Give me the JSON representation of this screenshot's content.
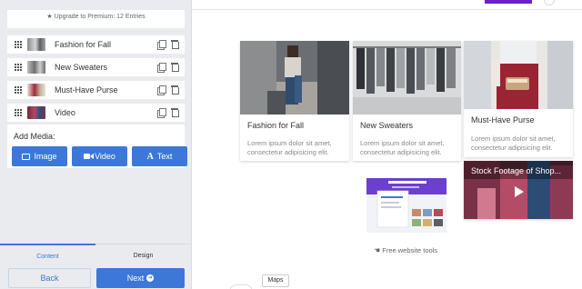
{
  "sidebar": {
    "upgrade_text": "Upgrade to Premium: 12 Entries",
    "items": [
      {
        "label": "Fashion for Fall"
      },
      {
        "label": "New Sweaters"
      },
      {
        "label": "Must-Have Purse"
      },
      {
        "label": "Video"
      }
    ],
    "add_media": {
      "title": "Add Media:",
      "image_label": "Image",
      "video_label": "Video",
      "text_label": "Text"
    },
    "tabs": {
      "content": "Content",
      "design": "Design"
    },
    "back_label": "Back",
    "next_label": "Next"
  },
  "preview": {
    "cards": [
      {
        "title": "Fashion for Fall",
        "desc": "Lorem ipsum dolor sit amet, consectetur adipisicing elit."
      },
      {
        "title": "New Sweaters",
        "desc": "Lorem ipsum dolor sit amet, consectetur adipisicing elit."
      },
      {
        "title": "Must-Have Purse",
        "desc": "Lorem ipsum dolor sit amet, consectetur adipisicing elit."
      }
    ],
    "video_title": "Stock Footage of Shop...",
    "promo_caption": "Free website tools",
    "maps_label": "Maps"
  },
  "colors": {
    "accent": "#3d78d8",
    "purple": "#6b21c8",
    "sidebar_bg": "#e9ebee"
  }
}
